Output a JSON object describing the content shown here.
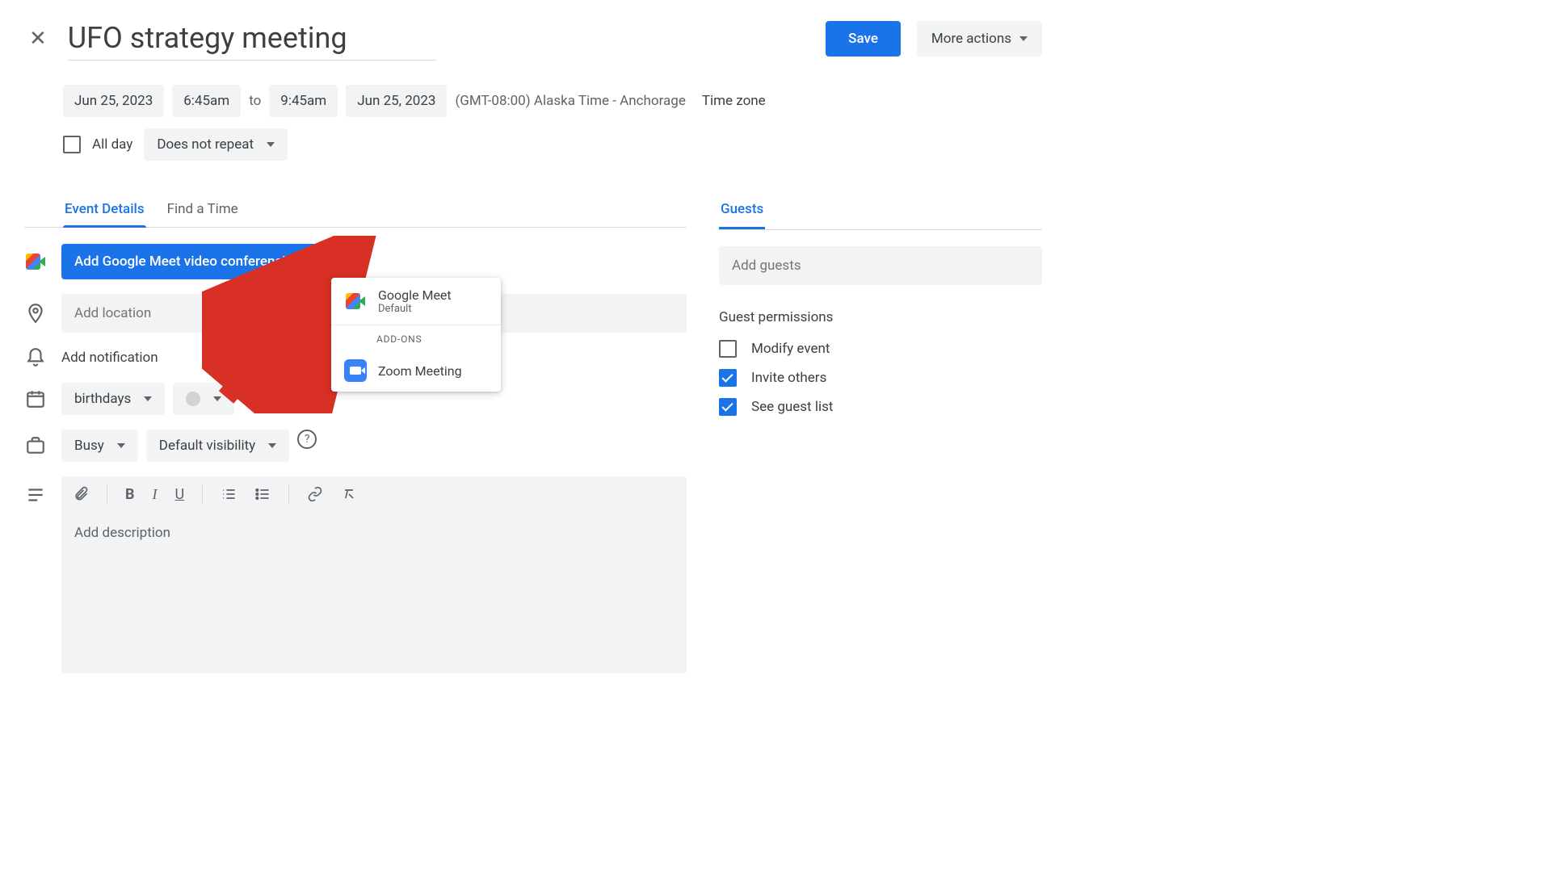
{
  "header": {
    "title": "UFO strategy meeting",
    "save_label": "Save",
    "more_actions_label": "More actions"
  },
  "datetime": {
    "start_date": "Jun 25, 2023",
    "start_time": "6:45am",
    "to_label": "to",
    "end_time": "9:45am",
    "end_date": "Jun 25, 2023",
    "timezone_text": "(GMT-08:00) Alaska Time - Anchorage",
    "timezone_link": "Time zone"
  },
  "allday": {
    "label": "All day",
    "repeat": "Does not repeat"
  },
  "tabs": {
    "event_details": "Event Details",
    "find_time": "Find a Time"
  },
  "conferencing": {
    "button_label": "Add Google Meet video conferencing",
    "popup": {
      "google_meet": "Google Meet",
      "default_label": "Default",
      "addons_label": "ADD-ONS",
      "zoom": "Zoom Meeting"
    }
  },
  "location": {
    "placeholder": "Add location"
  },
  "notification": {
    "label": "Add notification"
  },
  "calendar": {
    "name": "birthdays"
  },
  "availability": {
    "busy": "Busy",
    "visibility": "Default visibility"
  },
  "description": {
    "placeholder": "Add description"
  },
  "guests": {
    "header": "Guests",
    "placeholder": "Add guests",
    "permissions_title": "Guest permissions",
    "modify": "Modify event",
    "invite": "Invite others",
    "see_list": "See guest list"
  }
}
